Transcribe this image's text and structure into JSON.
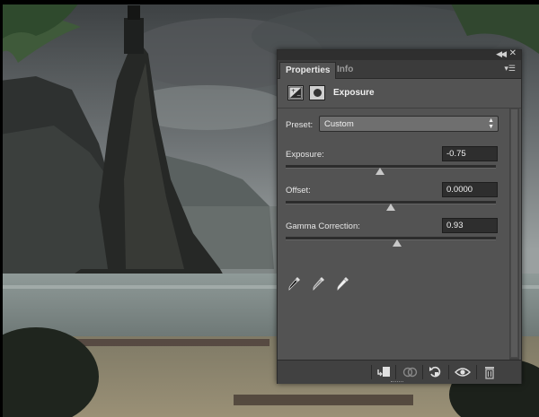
{
  "panel": {
    "tabs": [
      {
        "label": "Properties",
        "active": true
      },
      {
        "label": "Info",
        "active": false
      }
    ],
    "adjustment_title": "Exposure",
    "preset": {
      "label": "Preset:",
      "value": "Custom"
    },
    "fields": [
      {
        "label": "Exposure:",
        "value": "-0.75",
        "slider_fraction": 0.45
      },
      {
        "label": "Offset:",
        "value": "0.0000",
        "slider_fraction": 0.5
      },
      {
        "label": "Gamma Correction:",
        "value": "0.93",
        "slider_fraction": 0.53
      }
    ],
    "icons": {
      "top": [
        "collapse-icon",
        "close-icon",
        "panel-menu-icon"
      ],
      "header": [
        "exposure-adjustment-icon",
        "layer-mask-icon"
      ],
      "eyedroppers": [
        "black-point-eyedropper-icon",
        "gray-point-eyedropper-icon",
        "white-point-eyedropper-icon"
      ],
      "bottom": [
        "clip-to-layer-icon",
        "view-previous-state-icon",
        "reset-icon",
        "visibility-eye-icon",
        "delete-icon"
      ]
    },
    "colors": {
      "panel_bg": "#535353",
      "tab_bar": "#3b3b3b",
      "field_bg": "#2e2e2e"
    }
  }
}
